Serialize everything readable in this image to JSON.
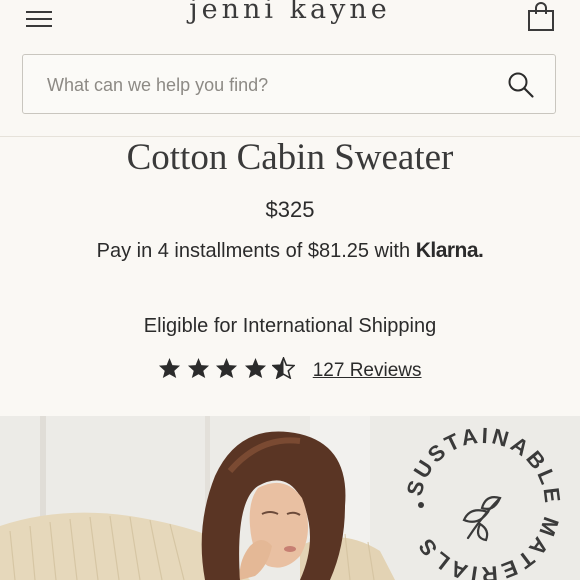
{
  "brand": {
    "logo_text": "jenni kayne"
  },
  "header": {
    "menu_icon": "hamburger-menu-icon",
    "bag_icon": "shopping-bag-icon"
  },
  "search": {
    "placeholder": "What can we help you find?",
    "value": "",
    "icon": "search-icon"
  },
  "product": {
    "title": "Cotton Cabin Sweater",
    "price": "$325",
    "installments_text": "Pay in 4 installments of $81.25 with",
    "klarna_label": "Klarna.",
    "shipping_text": "Eligible for International Shipping",
    "rating": 4.5,
    "rating_max": 5,
    "reviews_label": "127 Reviews"
  },
  "badge": {
    "text": "SUSTAINABLE MATERIALS",
    "icon": "leaf-icon"
  },
  "colors": {
    "background": "#faf8f4",
    "text": "#2b2b2b",
    "sweater": "#e6d8bb",
    "hair": "#5a3524"
  }
}
